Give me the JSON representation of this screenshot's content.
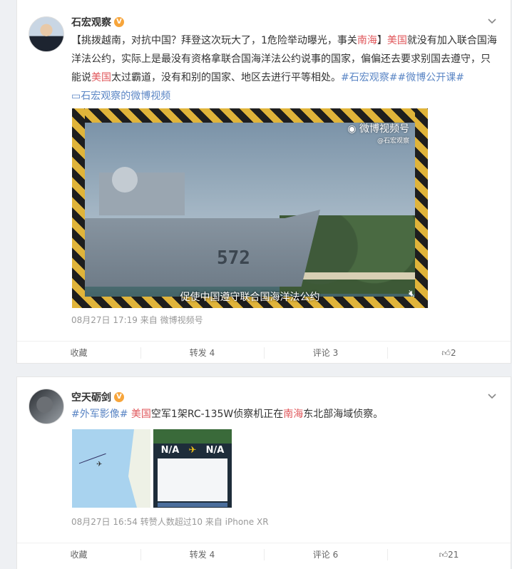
{
  "posts": [
    {
      "author": "石宏观察",
      "verified_badge": "V",
      "text": {
        "p1": "【挑拨越南，对抗中国？拜登这次玩大了，1危险举动曝光，事关",
        "kw_south_sea": "南海",
        "p2": "】",
        "kw_usa": "美国",
        "p3": "就没有加入联合国海洋法公约，实际上是最没有资格拿联合国海洋法公约说事的国家，偏偏还去要求别国去遵守，只能说",
        "kw_usa2": "美国",
        "p4": "太过霸道，没有和别的国家、地区去进行平等相处。",
        "tag1": "#石宏观察#",
        "tag2": "#微博公开课#",
        "video_link": "石宏观察的微博视频"
      },
      "video": {
        "watermark": "微博视频号",
        "watermark_sub": "@石宏观察",
        "hull_number": "572",
        "subtitle": "促使中国遵守联合国海洋法公约"
      },
      "meta": "08月27日 17:19  来自 微博视频号",
      "actions": {
        "favorite": "收藏",
        "repost": "转发 4",
        "comment": "评论 3",
        "like": "2"
      }
    },
    {
      "author": "空天砺剑",
      "verified_badge": "V",
      "text": {
        "tag": "#外军影像#",
        "kw_usa": "美国",
        "p1": "空军1架RC-135W侦察机正在",
        "kw_south_sea": "南海",
        "p2": "东北部海域侦察。"
      },
      "thumb_app": {
        "left": "N/A",
        "right": "N/A"
      },
      "meta": "08月27日 16:54 转赞人数超过10  来自 iPhone XR",
      "actions": {
        "favorite": "收藏",
        "repost": "转发 4",
        "comment": "评论 6",
        "like": "21"
      }
    }
  ],
  "colors": {
    "keyword_red": "#e0575b",
    "link_blue": "#5b86c5",
    "verified_orange": "#f7a53b"
  }
}
